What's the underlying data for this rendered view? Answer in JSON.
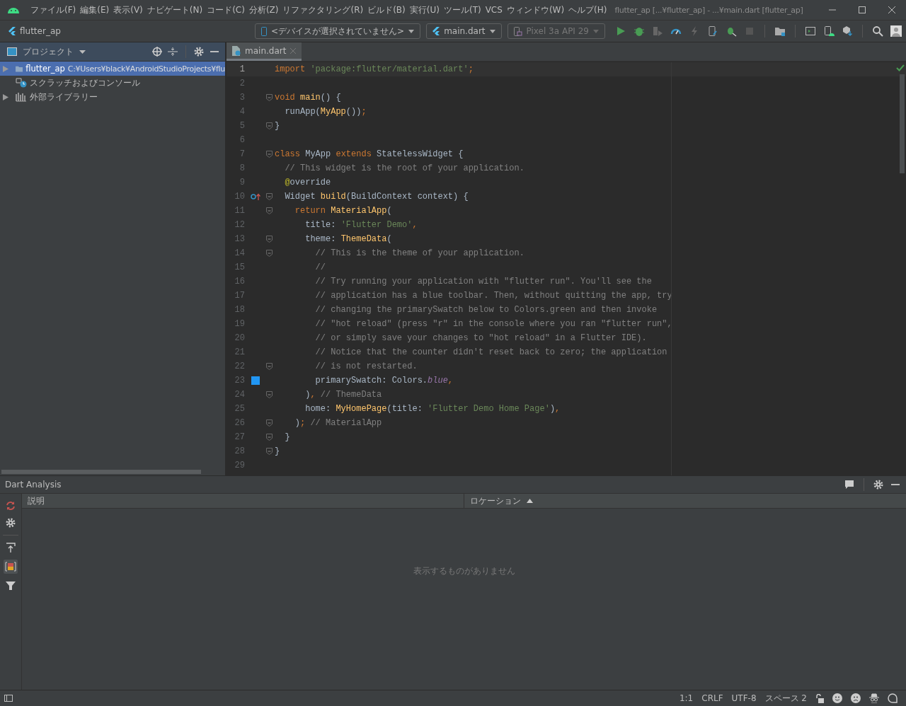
{
  "menu": [
    "ファイル(F)",
    "編集(E)",
    "表示(V)",
    "ナビゲート(N)",
    "コード(C)",
    "分析(Z)",
    "リファクタリング(R)",
    "ビルド(B)",
    "実行(U)",
    "ツール(T)",
    "VCS",
    "ウィンドウ(W)",
    "ヘルプ(H)"
  ],
  "window": {
    "title": "flutter_ap [...¥flutter_ap] - ...¥main.dart [flutter_ap]"
  },
  "toolbar": {
    "project": "flutter_ap",
    "device": "<デバイスが選択されていません>",
    "config": "main.dart",
    "emulator": "Pixel 3a API 29"
  },
  "project_panel": {
    "title": "プロジェクト",
    "items": [
      {
        "kind": "project",
        "name": "flutter_ap",
        "path": "C:¥Users¥black¥AndroidStudioProjects¥flu",
        "selected": true,
        "expandable": true
      },
      {
        "kind": "scratch",
        "name": "スクラッチおよびコンソール",
        "selected": false,
        "expandable": false
      },
      {
        "kind": "library",
        "name": "外部ライブラリー",
        "selected": false,
        "expandable": true
      }
    ]
  },
  "editor": {
    "tabs": [
      {
        "label": "main.dart",
        "selected": true
      }
    ],
    "lines": [
      {
        "n": "1",
        "current": true,
        "fold": false,
        "tokens": [
          {
            "kind": "kw",
            "text": "import "
          },
          {
            "kind": "str",
            "text": "'package:flutter/material.dart'"
          },
          {
            "kind": "kw",
            "text": ";"
          }
        ]
      },
      {
        "n": "2",
        "current": false,
        "fold": false
      },
      {
        "n": "3",
        "current": false,
        "fold": true,
        "tokens": [
          {
            "kind": "kw",
            "text": "void "
          },
          {
            "kind": "fn",
            "text": "main"
          },
          {
            "kind": "p",
            "text": "() {"
          }
        ]
      },
      {
        "n": "4",
        "current": false,
        "fold": false,
        "tokens": [
          {
            "kind": "p",
            "text": "  runApp("
          },
          {
            "kind": "fn",
            "text": "MyApp"
          },
          {
            "kind": "p",
            "text": "())"
          },
          {
            "kind": "kw",
            "text": ";"
          }
        ]
      },
      {
        "n": "5",
        "current": false,
        "fold": true,
        "tokens": [
          {
            "kind": "p",
            "text": "}"
          }
        ]
      },
      {
        "n": "6",
        "current": false,
        "fold": false
      },
      {
        "n": "7",
        "current": false,
        "fold": true,
        "tokens": [
          {
            "kind": "kw",
            "text": "class "
          },
          {
            "kind": "p",
            "text": "MyApp "
          },
          {
            "kind": "kw",
            "text": "extends "
          },
          {
            "kind": "p",
            "text": "StatelessWidget {"
          }
        ]
      },
      {
        "n": "8",
        "current": false,
        "fold": false,
        "tokens": [
          {
            "kind": "cmt",
            "text": "  // This widget is the root of your application."
          }
        ]
      },
      {
        "n": "9",
        "current": false,
        "fold": false,
        "tokens": [
          {
            "kind": "ann",
            "text": "  @"
          },
          {
            "kind": "p",
            "text": "override"
          }
        ]
      },
      {
        "n": "10",
        "current": false,
        "fold": true,
        "gutter_icon": {
          "kind": "override"
        },
        "tokens": [
          {
            "kind": "p",
            "text": "  Widget "
          },
          {
            "kind": "fn",
            "text": "build"
          },
          {
            "kind": "p",
            "text": "(BuildContext context) {"
          }
        ]
      },
      {
        "n": "11",
        "current": false,
        "fold": true,
        "tokens": [
          {
            "kind": "kw",
            "text": "    return "
          },
          {
            "kind": "fn",
            "text": "MaterialApp"
          },
          {
            "kind": "p",
            "text": "("
          }
        ]
      },
      {
        "n": "12",
        "current": false,
        "fold": false,
        "tokens": [
          {
            "kind": "p",
            "text": "      title: "
          },
          {
            "kind": "str",
            "text": "'Flutter Demo'"
          },
          {
            "kind": "kw",
            "text": ","
          }
        ]
      },
      {
        "n": "13",
        "current": false,
        "fold": true,
        "tokens": [
          {
            "kind": "p",
            "text": "      theme: "
          },
          {
            "kind": "fn",
            "text": "ThemeData"
          },
          {
            "kind": "p",
            "text": "("
          }
        ]
      },
      {
        "n": "14",
        "current": false,
        "fold": true,
        "tokens": [
          {
            "kind": "cmt",
            "text": "        // This is the theme of your application."
          }
        ]
      },
      {
        "n": "15",
        "current": false,
        "fold": false,
        "tokens": [
          {
            "kind": "cmt",
            "text": "        //"
          }
        ]
      },
      {
        "n": "16",
        "current": false,
        "fold": false,
        "tokens": [
          {
            "kind": "cmt",
            "text": "        // Try running your application with \"flutter run\". You'll see the"
          }
        ]
      },
      {
        "n": "17",
        "current": false,
        "fold": false,
        "tokens": [
          {
            "kind": "cmt",
            "text": "        // application has a blue toolbar. Then, without quitting the app, try"
          }
        ]
      },
      {
        "n": "18",
        "current": false,
        "fold": false,
        "tokens": [
          {
            "kind": "cmt",
            "text": "        // changing the primarySwatch below to Colors.green and then invoke"
          }
        ]
      },
      {
        "n": "19",
        "current": false,
        "fold": false,
        "tokens": [
          {
            "kind": "cmt",
            "text": "        // \"hot reload\" (press \"r\" in the console where you ran \"flutter run\","
          }
        ]
      },
      {
        "n": "20",
        "current": false,
        "fold": false,
        "tokens": [
          {
            "kind": "cmt",
            "text": "        // or simply save your changes to \"hot reload\" in a Flutter IDE)."
          }
        ]
      },
      {
        "n": "21",
        "current": false,
        "fold": false,
        "tokens": [
          {
            "kind": "cmt",
            "text": "        // Notice that the counter didn't reset back to zero; the application"
          }
        ]
      },
      {
        "n": "22",
        "current": false,
        "fold": true,
        "tokens": [
          {
            "kind": "cmt",
            "text": "        // is not restarted."
          }
        ]
      },
      {
        "n": "23",
        "current": false,
        "fold": false,
        "gutter_icon": {
          "kind": "swatch"
        },
        "color": "#2196f3",
        "tokens": [
          {
            "kind": "p",
            "text": "        primarySwatch: Colors."
          },
          {
            "kind": "it",
            "text": "blue"
          },
          {
            "kind": "kw",
            "text": ","
          }
        ]
      },
      {
        "n": "24",
        "current": false,
        "fold": true,
        "tokens": [
          {
            "kind": "p",
            "text": "      )"
          },
          {
            "kind": "kw",
            "text": ","
          },
          {
            "kind": "cmt",
            "text": " // ThemeData"
          }
        ]
      },
      {
        "n": "25",
        "current": false,
        "fold": false,
        "tokens": [
          {
            "kind": "p",
            "text": "      home: "
          },
          {
            "kind": "fn",
            "text": "MyHomePage"
          },
          {
            "kind": "p",
            "text": "(title: "
          },
          {
            "kind": "str",
            "text": "'Flutter Demo Home Page'"
          },
          {
            "kind": "p",
            "text": ")"
          },
          {
            "kind": "kw",
            "text": ","
          }
        ]
      },
      {
        "n": "26",
        "current": false,
        "fold": true,
        "tokens": [
          {
            "kind": "p",
            "text": "    )"
          },
          {
            "kind": "kw",
            "text": ";"
          },
          {
            "kind": "cmt",
            "text": " // MaterialApp"
          }
        ]
      },
      {
        "n": "27",
        "current": false,
        "fold": true,
        "tokens": [
          {
            "kind": "p",
            "text": "  }"
          }
        ]
      },
      {
        "n": "28",
        "current": false,
        "fold": true,
        "tokens": [
          {
            "kind": "p",
            "text": "}"
          }
        ]
      },
      {
        "n": "29",
        "current": false,
        "fold": false
      }
    ]
  },
  "analysis": {
    "title": "Dart Analysis",
    "columns": [
      {
        "label": "説明",
        "sorted_ascending": false
      },
      {
        "label": "ロケーション",
        "sorted_ascending": true
      }
    ],
    "empty": "表示するものがありません"
  },
  "status_bar": [
    "1:1",
    "CRLF",
    "UTF-8",
    "スペース 2"
  ]
}
